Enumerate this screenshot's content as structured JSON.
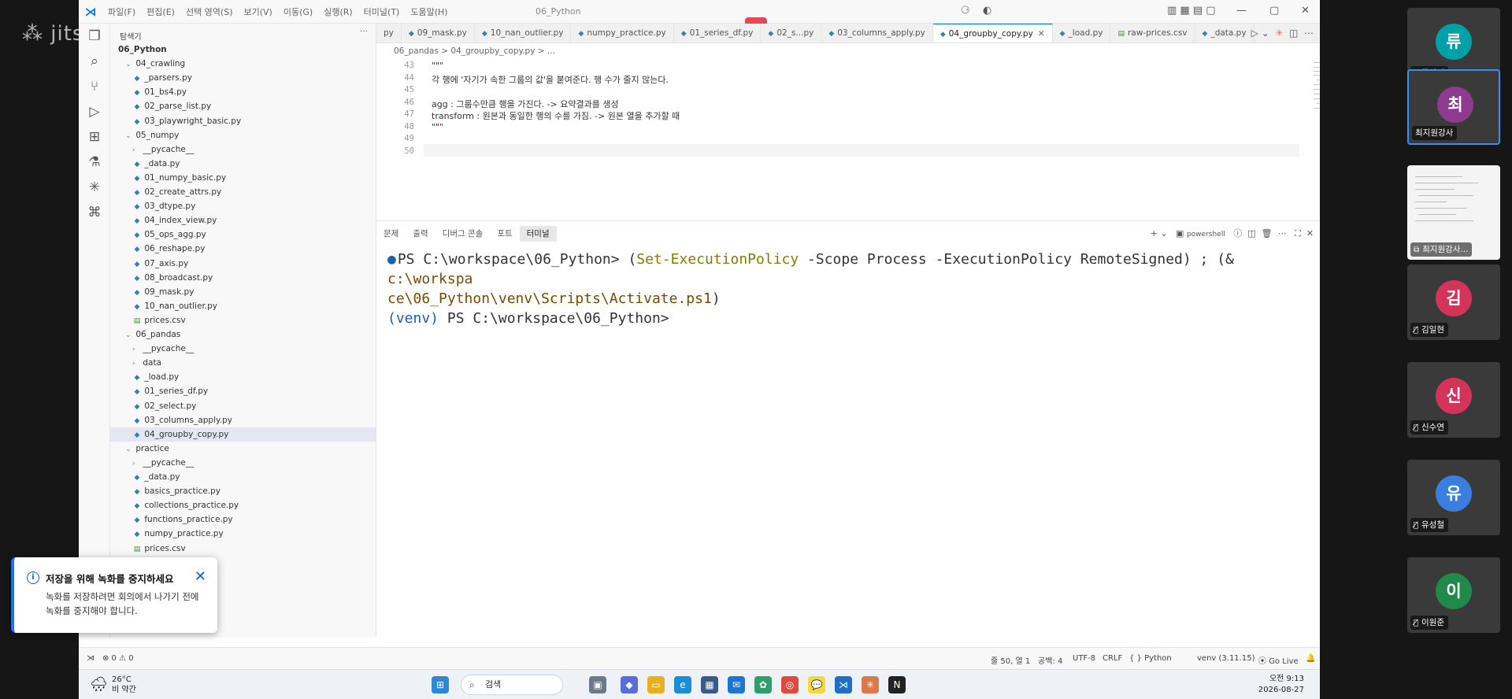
{
  "titlebar": {
    "menus": [
      "파일(F)",
      "편집(E)",
      "선택 영역(S)",
      "보기(V)",
      "이동(G)",
      "실행(R)",
      "터미널(T)",
      "도움말(H)"
    ],
    "window_title": "06_Python"
  },
  "explorer": {
    "title": "탐색기",
    "more": "···",
    "items": [
      {
        "label": "06_Python",
        "indent": 0,
        "kind": "root"
      },
      {
        "label": "04_crawling",
        "indent": 1,
        "kind": "folder-open"
      },
      {
        "label": "_parsers.py",
        "indent": 2,
        "kind": "py"
      },
      {
        "label": "01_bs4.py",
        "indent": 2,
        "kind": "py"
      },
      {
        "label": "02_parse_list.py",
        "indent": 2,
        "kind": "py"
      },
      {
        "label": "03_playwright_basic.py",
        "indent": 2,
        "kind": "py"
      },
      {
        "label": "05_numpy",
        "indent": 1,
        "kind": "folder-open"
      },
      {
        "label": "__pycache__",
        "indent": 2,
        "kind": "folder"
      },
      {
        "label": "_data.py",
        "indent": 2,
        "kind": "py"
      },
      {
        "label": "01_numpy_basic.py",
        "indent": 2,
        "kind": "py"
      },
      {
        "label": "02_create_attrs.py",
        "indent": 2,
        "kind": "py"
      },
      {
        "label": "03_dtype.py",
        "indent": 2,
        "kind": "py"
      },
      {
        "label": "04_index_view.py",
        "indent": 2,
        "kind": "py"
      },
      {
        "label": "05_ops_agg.py",
        "indent": 2,
        "kind": "py"
      },
      {
        "label": "06_reshape.py",
        "indent": 2,
        "kind": "py"
      },
      {
        "label": "07_axis.py",
        "indent": 2,
        "kind": "py"
      },
      {
        "label": "08_broadcast.py",
        "indent": 2,
        "kind": "py"
      },
      {
        "label": "09_mask.py",
        "indent": 2,
        "kind": "py"
      },
      {
        "label": "10_nan_outlier.py",
        "indent": 2,
        "kind": "py"
      },
      {
        "label": "prices.csv",
        "indent": 2,
        "kind": "csv"
      },
      {
        "label": "06_pandas",
        "indent": 1,
        "kind": "folder-open"
      },
      {
        "label": "__pycache__",
        "indent": 2,
        "kind": "folder"
      },
      {
        "label": "data",
        "indent": 2,
        "kind": "folder"
      },
      {
        "label": "_load.py",
        "indent": 2,
        "kind": "py"
      },
      {
        "label": "01_series_df.py",
        "indent": 2,
        "kind": "py"
      },
      {
        "label": "02_select.py",
        "indent": 2,
        "kind": "py"
      },
      {
        "label": "03_columns_apply.py",
        "indent": 2,
        "kind": "py"
      },
      {
        "label": "04_groupby_copy.py",
        "indent": 2,
        "kind": "py",
        "selected": true
      },
      {
        "label": "practice",
        "indent": 1,
        "kind": "folder-open"
      },
      {
        "label": "__pycache__",
        "indent": 2,
        "kind": "folder"
      },
      {
        "label": "_data.py",
        "indent": 2,
        "kind": "py"
      },
      {
        "label": "basics_practice.py",
        "indent": 2,
        "kind": "py"
      },
      {
        "label": "collections_practice.py",
        "indent": 2,
        "kind": "py"
      },
      {
        "label": "functions_practice.py",
        "indent": 2,
        "kind": "py"
      },
      {
        "label": "numpy_practice.py",
        "indent": 2,
        "kind": "py"
      },
      {
        "label": "prices.csv",
        "indent": 2,
        "kind": "csv"
      }
    ]
  },
  "tabs": [
    {
      "label": "py",
      "icon": false
    },
    {
      "label": "09_mask.py",
      "icon": true
    },
    {
      "label": "10_nan_outlier.py",
      "icon": true
    },
    {
      "label": "numpy_practice.py",
      "icon": true
    },
    {
      "label": "01_series_df.py",
      "icon": true
    },
    {
      "label": "02_s...py",
      "icon": true
    },
    {
      "label": "03_columns_apply.py",
      "icon": true
    },
    {
      "label": "04_groupby_copy.py",
      "icon": true,
      "active": true
    },
    {
      "label": "_load.py",
      "icon": true
    },
    {
      "label": "raw-prices.csv",
      "icon": true,
      "csv": true
    },
    {
      "label": "_data.py",
      "icon": true
    }
  ],
  "breadcrumb": "06_pandas  >  04_groupby_copy.py  > ...",
  "editor": {
    "lines": [
      {
        "num": "43",
        "text": "\"\"\"",
        "cls": "str"
      },
      {
        "num": "44",
        "text": "각 행에 '자기가 속한 그룹의 값'을 붙여준다. 행 수가 줄지 않는다.",
        "cls": ""
      },
      {
        "num": "45",
        "text": "",
        "cls": ""
      },
      {
        "num": "46",
        "text": "agg : 그룹수만큼 행을 가진다. -> 요약결과를 생성",
        "cls": ""
      },
      {
        "num": "47",
        "text": "transform : 원본과 동일한 행의 수를 가짐. -> 원본 열을 추가할 때",
        "cls": ""
      },
      {
        "num": "48",
        "text": "\"\"\"",
        "cls": "str"
      },
      {
        "num": "49",
        "text": "",
        "cls": ""
      },
      {
        "num": "50",
        "text": "",
        "cls": ""
      }
    ]
  },
  "panel": {
    "tabs": [
      "문제",
      "출력",
      "디버그 콘솔",
      "포트",
      "터미널"
    ],
    "active_tab": "터미널",
    "shell_label": "powershell",
    "terminal": {
      "prompt1": "PS C:\\workspace\\06_Python>",
      "cmd_open": "(",
      "cmd_name": "Set-ExecutionPolicy",
      "cmd_args": " -Scope Process -ExecutionPolicy RemoteSigned",
      "cmd_close": ") ; (&",
      "cmd_path1": " c:\\workspa",
      "cmd_path2": "ce\\06_Python\\venv\\Scripts\\Activate.ps1",
      "cmd_end": ")",
      "venv": "(venv)",
      "prompt2": " PS C:\\workspace\\06_Python>"
    }
  },
  "statusbar": {
    "problems": "⊗ 0 ⚠ 0",
    "position": "줄 50, 열 1",
    "spaces": "공백: 4",
    "encoding": "UTF-8",
    "eol": "CRLF",
    "language": "{ }  Python",
    "interpreter": "venv (3.11.15)",
    "golive": "Go Live"
  },
  "taskbar": {
    "temp": "26°C",
    "weather": "비 약간",
    "search_placeholder": "검색",
    "time": "오전 9:13",
    "date": "2026-08-27"
  },
  "toast": {
    "title": "저장을 위해 녹화를 중지하세요",
    "message": "녹화를 저장하려면 회의에서 나가기 전에 녹화를 중지해야 합니다."
  },
  "participants": [
    {
      "initial": "류",
      "name": "류상민",
      "color": "#00a0a8",
      "muted": true
    },
    {
      "initial": "최",
      "name": "최지원강사",
      "color": "#8e3a8e",
      "muted": false,
      "active": true
    },
    {
      "initial": "",
      "name": "최지원강사...",
      "color": "",
      "share": true
    },
    {
      "initial": "김",
      "name": "김일현",
      "color": "#d4335a",
      "muted": true
    },
    {
      "initial": "신",
      "name": "신수연",
      "color": "#d4335a",
      "muted": true
    },
    {
      "initial": "유",
      "name": "유성철",
      "color": "#3a7ee0",
      "muted": true
    },
    {
      "initial": "이",
      "name": "이원준",
      "color": "#1f8a4a",
      "muted": true
    }
  ]
}
